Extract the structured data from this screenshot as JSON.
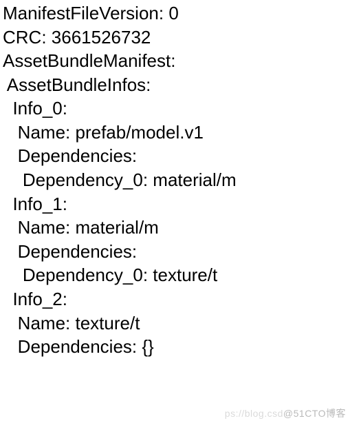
{
  "manifest": {
    "ManifestFileVersion": "0",
    "CRC": "3661526732",
    "AssetBundleManifest": {
      "AssetBundleInfos": {
        "Info_0": {
          "Name": "prefab/model.v1",
          "Dependencies": {
            "Dependency_0": "material/m"
          }
        },
        "Info_1": {
          "Name": "material/m",
          "Dependencies": {
            "Dependency_0": "texture/t"
          }
        },
        "Info_2": {
          "Name": "texture/t",
          "Dependencies": "{}"
        }
      }
    }
  },
  "watermark": {
    "faint": "ps://blog.csd",
    "text": "@51CTO博客"
  }
}
